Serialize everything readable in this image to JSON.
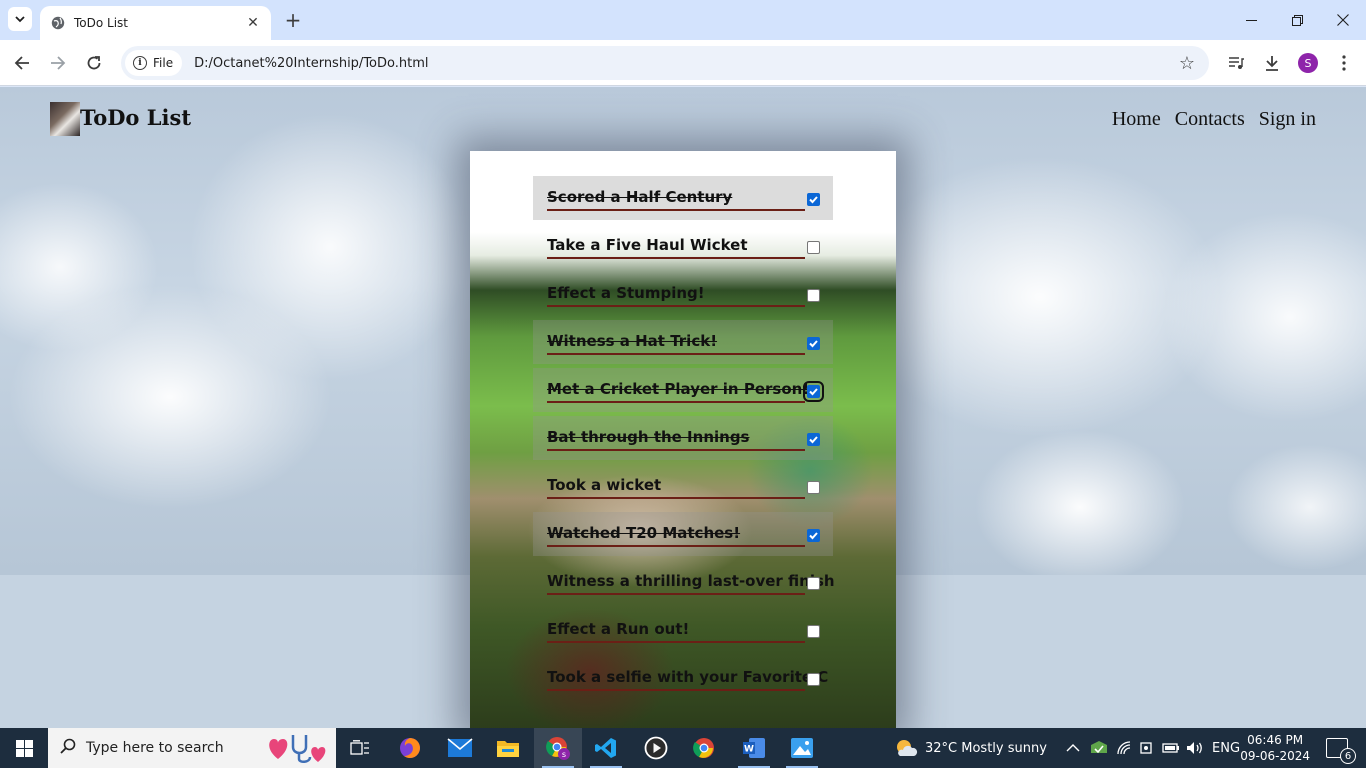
{
  "browser": {
    "tab_title": "ToDo List",
    "chip_label": "File",
    "url": "D:/Octanet%20Internship/ToDo.html",
    "profile_initial": "S"
  },
  "site": {
    "title": "ToDo List",
    "nav": [
      "Home",
      "Contacts",
      "Sign in"
    ]
  },
  "todos": [
    {
      "text": "Scored a Half Century",
      "checked": true
    },
    {
      "text": "Take a Five Haul Wicket",
      "checked": false
    },
    {
      "text": "Effect a Stumping!",
      "checked": false
    },
    {
      "text": "Witness a Hat Trick!",
      "checked": true
    },
    {
      "text": "Met a Cricket Player in Person!",
      "checked": true
    },
    {
      "text": "Bat through the Innings",
      "checked": true
    },
    {
      "text": "Took a wicket",
      "checked": false
    },
    {
      "text": "Watched T20 Matches!",
      "checked": true
    },
    {
      "text": "Witness a thrilling last-over finish",
      "checked": false
    },
    {
      "text": "Effect a Run out!",
      "checked": false
    },
    {
      "text": "Took a selfie with your Favorite C",
      "checked": false
    }
  ],
  "taskbar": {
    "search_placeholder": "Type here to search",
    "weather": "32°C  Mostly sunny",
    "language": "ENG",
    "time": "06:46 PM",
    "date": "09-06-2024",
    "notification_count": "6"
  }
}
